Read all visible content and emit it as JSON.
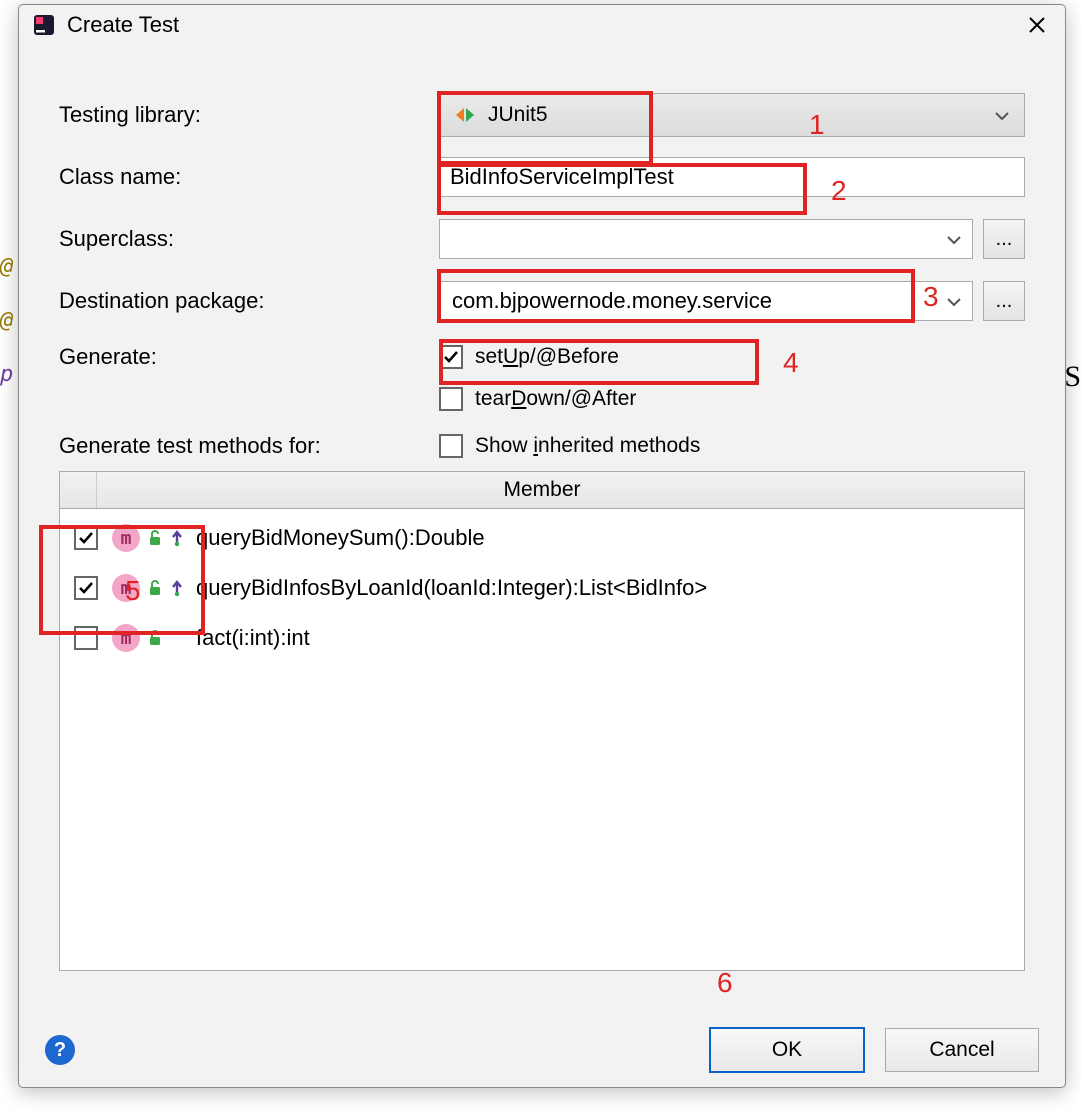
{
  "dialog": {
    "title": "Create Test",
    "labels": {
      "testing_library": "Testing library:",
      "class_name": "Class name:",
      "superclass": "Superclass:",
      "destination_package": "Destination package:",
      "generate": "Generate:",
      "generate_test_methods": "Generate test methods for:",
      "member_header": "Member"
    },
    "fields": {
      "testing_library": "JUnit5",
      "class_name": "BidInfoServiceImplTest",
      "superclass": "",
      "destination_package": "com.bjpowernode.money.service"
    },
    "generate_options": {
      "setup": {
        "label_pre": "set",
        "label_u": "U",
        "label_post": "p/@Before",
        "checked": true
      },
      "teardown": {
        "label_pre": "tear",
        "label_u": "D",
        "label_post": "own/@After",
        "checked": false
      }
    },
    "show_inherited": {
      "label_pre": "Show ",
      "label_u": "i",
      "label_post": "nherited methods",
      "checked": false
    },
    "members": [
      {
        "checked": true,
        "signature": "queryBidMoneySum():Double",
        "has_override": true
      },
      {
        "checked": true,
        "signature": "queryBidInfosByLoanId(loanId:Integer):List<BidInfo>",
        "has_override": true
      },
      {
        "checked": false,
        "signature": "fact(i:int):int",
        "has_override": false
      }
    ],
    "buttons": {
      "ok": "OK",
      "cancel": "Cancel",
      "browse": "..."
    }
  },
  "annotations": {
    "n1": "1",
    "n2": "2",
    "n3": "3",
    "n4": "4",
    "n5": "5",
    "n6": "6"
  }
}
